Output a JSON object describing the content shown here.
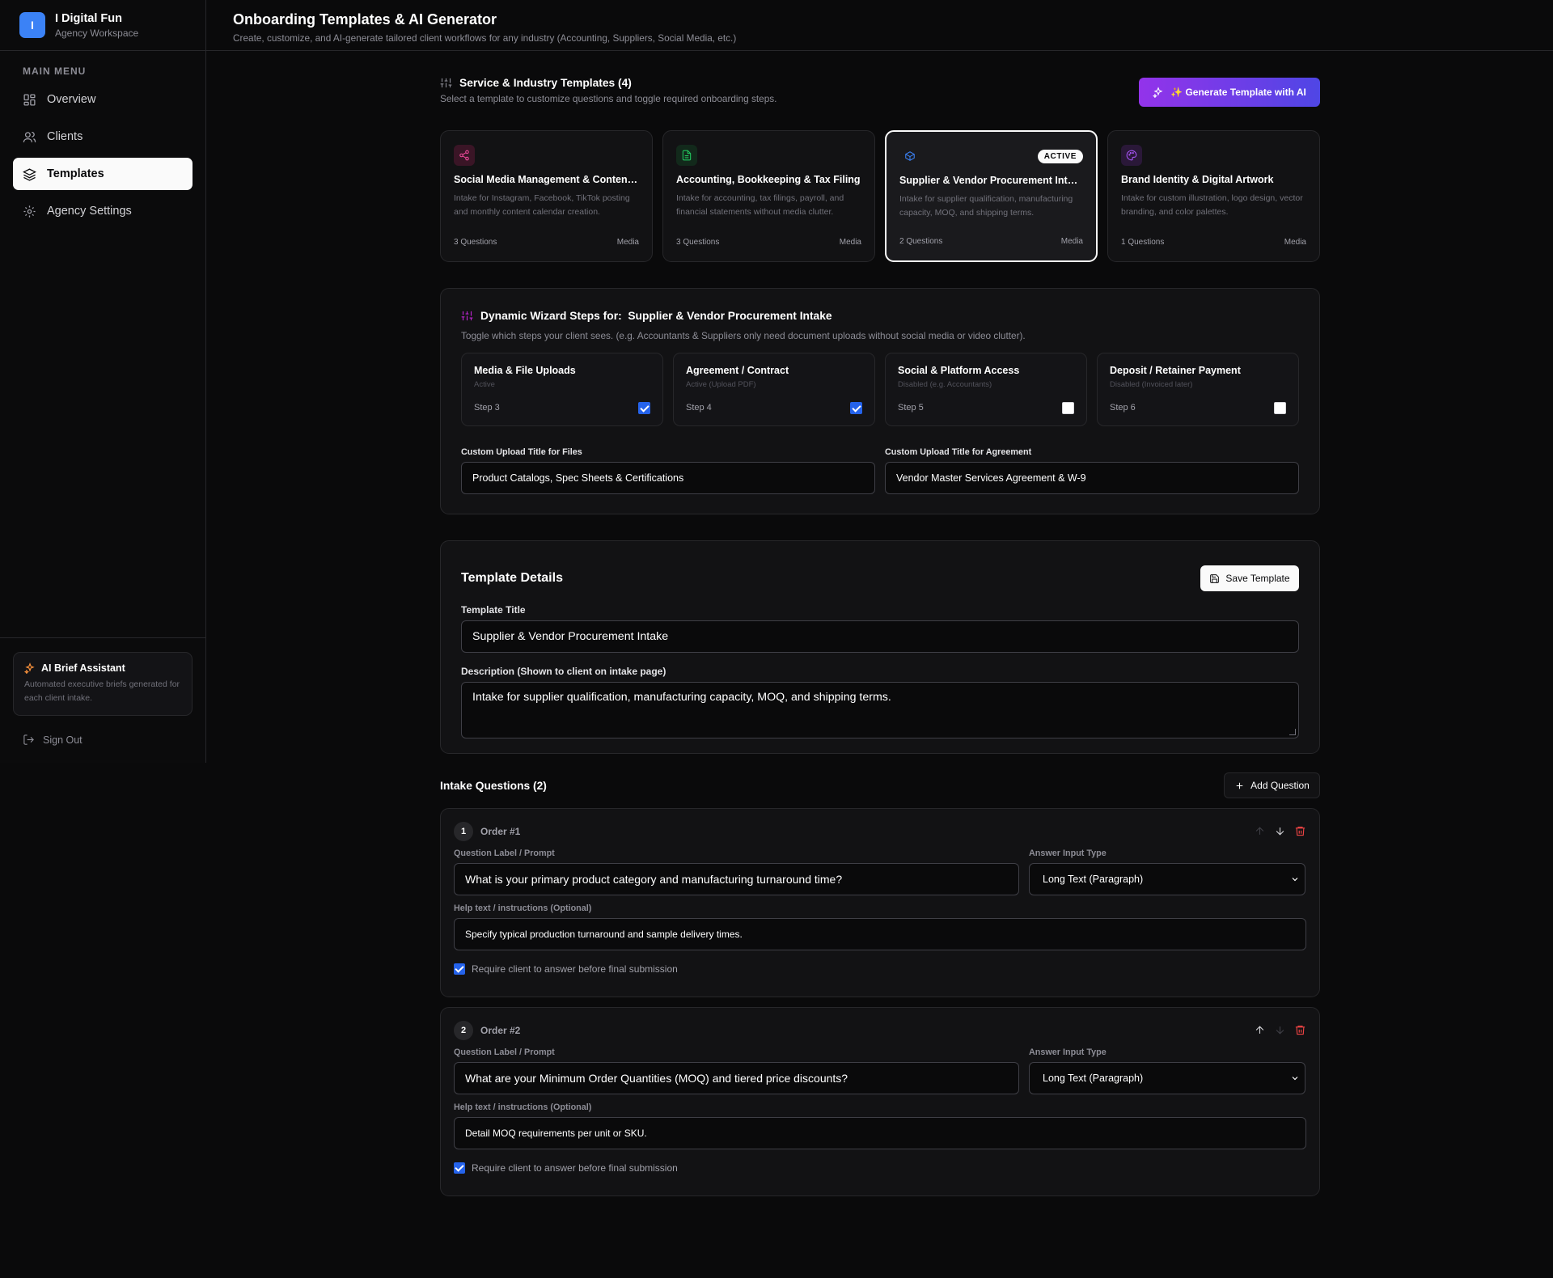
{
  "app": {
    "logo_letter": "I",
    "name": "I Digital Fun",
    "subtitle": "Agency Workspace"
  },
  "sidebar": {
    "menu_label": "MAIN MENU",
    "items": [
      {
        "label": "Overview",
        "icon": "grid-icon",
        "active": false
      },
      {
        "label": "Clients",
        "icon": "users-icon",
        "active": false
      },
      {
        "label": "Templates",
        "icon": "layers-icon",
        "active": true
      },
      {
        "label": "Agency Settings",
        "icon": "gear-icon",
        "active": false
      }
    ],
    "brief": {
      "title": "AI Brief Assistant",
      "description": "Automated executive briefs generated for each client intake."
    },
    "sign_out": "Sign Out"
  },
  "header": {
    "title": "Onboarding Templates & AI Generator",
    "subtitle": "Create, customize, and AI-generate tailored client workflows for any industry (Accounting, Suppliers, Social Media, etc.)"
  },
  "templates": {
    "title": "Service & Industry Templates (4)",
    "subtitle": "Select a template to customize questions and toggle required onboarding steps.",
    "generate_button": "✨ Generate Template with AI",
    "active_badge": "ACTIVE",
    "cards": [
      {
        "title": "Social Media Management & Content...",
        "description": "Intake for Instagram, Facebook, TikTok posting and monthly content calendar creation.",
        "questions": "3 Questions",
        "tag": "Media",
        "icon": "share-icon",
        "icon_color": "#ec4899",
        "icon_bg": "#3a1526"
      },
      {
        "title": "Accounting, Bookkeeping & Tax Filing",
        "description": "Intake for accounting, tax filings, payroll, and financial statements without media clutter.",
        "questions": "3 Questions",
        "tag": "Media",
        "icon": "document-icon",
        "icon_color": "#22c55e",
        "icon_bg": "#12291b"
      },
      {
        "title": "Supplier & Vendor Procurement Intake",
        "description": "Intake for supplier qualification, manufacturing capacity, MOQ, and shipping terms.",
        "questions": "2 Questions",
        "tag": "Media",
        "icon": "box-icon",
        "icon_color": "#3b82f6",
        "icon_bg": "#1a1a1d"
      },
      {
        "title": "Brand Identity & Digital Artwork",
        "description": "Intake for custom illustration, logo design, vector branding, and color palettes.",
        "questions": "1 Questions",
        "tag": "Media",
        "icon": "palette-icon",
        "icon_color": "#a855f7",
        "icon_bg": "#2a1838"
      }
    ]
  },
  "wizard": {
    "title_prefix": "Dynamic Wizard Steps for:",
    "title_name": "Supplier & Vendor Procurement Intake",
    "subtitle": "Toggle which steps your client sees. (e.g. Accountants & Suppliers only need document uploads without social media or video clutter).",
    "steps": [
      {
        "title": "Media & File Uploads",
        "status": "Active",
        "step": "Step 3",
        "checked": true
      },
      {
        "title": "Agreement / Contract",
        "status": "Active (Upload PDF)",
        "step": "Step 4",
        "checked": true
      },
      {
        "title": "Social & Platform Access",
        "status": "Disabled (e.g. Accountants)",
        "step": "Step 5",
        "checked": false
      },
      {
        "title": "Deposit / Retainer Payment",
        "status": "Disabled (Invoiced later)",
        "step": "Step 6",
        "checked": false
      }
    ],
    "files_label": "Custom Upload Title for Files",
    "files_value": "Product Catalogs, Spec Sheets & Certifications",
    "agreement_label": "Custom Upload Title for Agreement",
    "agreement_value": "Vendor Master Services Agreement & W-9"
  },
  "details": {
    "title": "Template Details",
    "save_button": "Save Template",
    "title_label": "Template Title",
    "title_value": "Supplier & Vendor Procurement Intake",
    "description_label": "Description (Shown to client on intake page)",
    "description_value": "Intake for supplier qualification, manufacturing capacity, MOQ, and shipping terms."
  },
  "questions": {
    "title": "Intake Questions (2)",
    "add_button": "Add Question",
    "prompt_label": "Question Label / Prompt",
    "type_label": "Answer Input Type",
    "help_label": "Help text / instructions (Optional)",
    "required_label": "Require client to answer before final submission",
    "items": [
      {
        "number": "1",
        "order": "Order #1",
        "prompt": "What is your primary product category and manufacturing turnaround time?",
        "type": "Long Text (Paragraph)",
        "help": "Specify typical production turnaround and sample delivery times.",
        "required": true,
        "up_enabled": false,
        "down_enabled": true
      },
      {
        "number": "2",
        "order": "Order #2",
        "prompt": "What are your Minimum Order Quantities (MOQ) and tiered price discounts?",
        "type": "Long Text (Paragraph)",
        "help": "Detail MOQ requirements per unit or SKU.",
        "required": true,
        "up_enabled": true,
        "down_enabled": false
      }
    ]
  },
  "colors": {
    "accent": "#2563eb",
    "brand": "#3b82f6",
    "danger": "#ef4444",
    "gradient_start": "#9333ea",
    "gradient_end": "#4f46e5"
  }
}
